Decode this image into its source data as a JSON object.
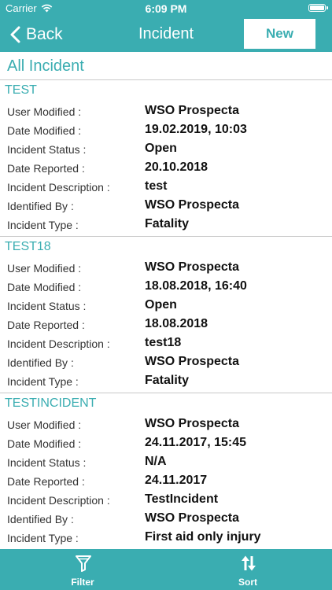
{
  "status_bar": {
    "carrier": "Carrier",
    "time": "6:09 PM"
  },
  "nav": {
    "back_label": "Back",
    "title": "Incident",
    "new_label": "New"
  },
  "list_header": "All Incident",
  "incidents": [
    {
      "name": "TEST",
      "fields": [
        {
          "label": "User Modified :",
          "value": "WSO Prospecta"
        },
        {
          "label": "Date Modified :",
          "value": "19.02.2019, 10:03"
        },
        {
          "label": "Incident Status :",
          "value": "Open"
        },
        {
          "label": "Date Reported :",
          "value": "20.10.2018"
        },
        {
          "label": "Incident Description :",
          "value": "test"
        },
        {
          "label": "Identified By :",
          "value": "WSO Prospecta"
        },
        {
          "label": "Incident Type :",
          "value": "Fatality"
        }
      ]
    },
    {
      "name": "TEST18",
      "fields": [
        {
          "label": "User Modified :",
          "value": "WSO Prospecta"
        },
        {
          "label": "Date Modified :",
          "value": "18.08.2018, 16:40"
        },
        {
          "label": "Incident Status :",
          "value": "Open"
        },
        {
          "label": "Date Reported :",
          "value": "18.08.2018"
        },
        {
          "label": "Incident Description :",
          "value": "test18"
        },
        {
          "label": "Identified By :",
          "value": "WSO Prospecta"
        },
        {
          "label": "Incident Type :",
          "value": "Fatality"
        }
      ]
    },
    {
      "name": "TESTINCIDENT",
      "fields": [
        {
          "label": "User Modified :",
          "value": "WSO Prospecta"
        },
        {
          "label": "Date Modified :",
          "value": "24.11.2017, 15:45"
        },
        {
          "label": "Incident Status :",
          "value": "N/A"
        },
        {
          "label": "Date Reported :",
          "value": "24.11.2017"
        },
        {
          "label": "Incident Description :",
          "value": "TestIncident"
        },
        {
          "label": "Identified By :",
          "value": "WSO Prospecta"
        },
        {
          "label": "Incident Type :",
          "value": "First aid only injury"
        }
      ]
    }
  ],
  "tabbar": {
    "filter": {
      "label": "Filter",
      "icon": "filter-icon"
    },
    "sort": {
      "label": "Sort",
      "icon": "sort-icon"
    }
  },
  "colors": {
    "accent": "#3aadb1",
    "divider": "#c9c9c9",
    "background": "#ffffff"
  }
}
